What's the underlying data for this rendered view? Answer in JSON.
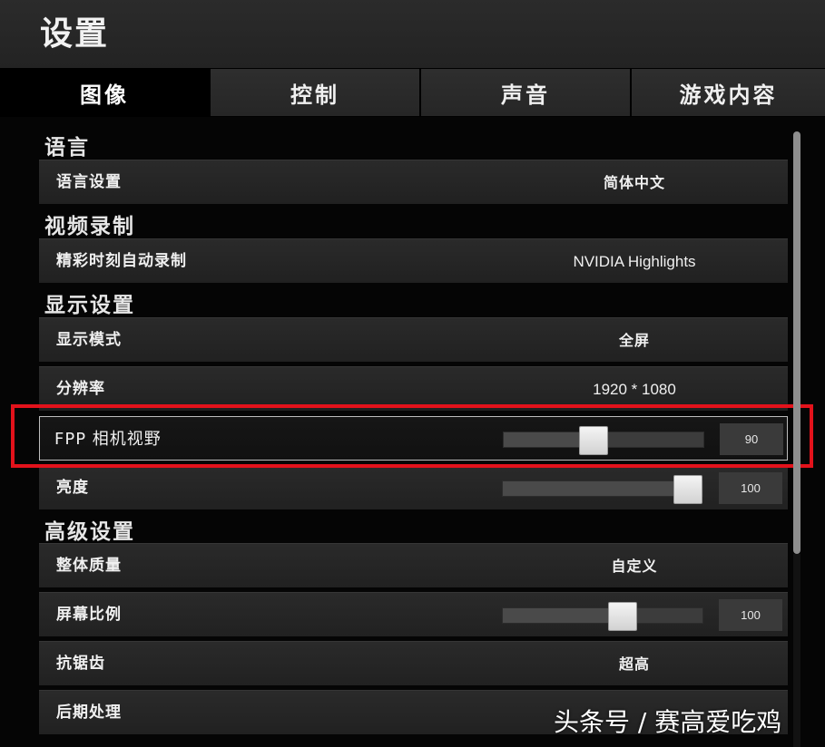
{
  "header": {
    "title": "设置"
  },
  "tabs": [
    {
      "label": "图像",
      "active": true
    },
    {
      "label": "控制",
      "active": false
    },
    {
      "label": "声音",
      "active": false
    },
    {
      "label": "游戏内容",
      "active": false
    }
  ],
  "sections": {
    "language": {
      "title": "语言",
      "language_setting": {
        "label": "语言设置",
        "value": "简体中文"
      }
    },
    "video_recording": {
      "title": "视频录制",
      "auto_highlights": {
        "label": "精彩时刻自动录制",
        "value": "NVIDIA Highlights"
      }
    },
    "display": {
      "title": "显示设置",
      "display_mode": {
        "label": "显示模式",
        "value": "全屏"
      },
      "resolution": {
        "label": "分辨率",
        "value": "1920 * 1080"
      },
      "fpp_fov": {
        "label": "FPP 相机视野",
        "value": "90",
        "fraction": 0.45
      },
      "brightness": {
        "label": "亮度",
        "value": "100",
        "fraction": 1.0
      }
    },
    "advanced": {
      "title": "高级设置",
      "overall_quality": {
        "label": "整体质量",
        "value": "自定义"
      },
      "screen_scale": {
        "label": "屏幕比例",
        "value": "100",
        "fraction": 0.6
      },
      "anti_aliasing": {
        "label": "抗锯齿",
        "value": "超高"
      },
      "post_processing": {
        "label": "后期处理",
        "value": ""
      }
    }
  },
  "watermark": "头条号 / 赛高爱吃鸡",
  "colors": {
    "highlight": "#e3121b",
    "panel": "#262626",
    "background": "#050505"
  }
}
